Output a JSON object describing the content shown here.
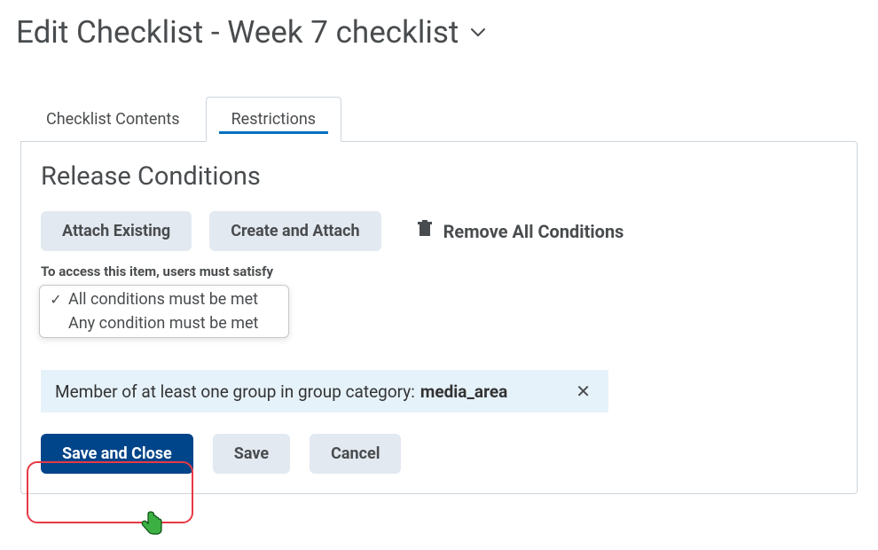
{
  "page_title": "Edit Checklist - Week 7 checklist",
  "tabs": {
    "contents": "Checklist Contents",
    "restrictions": "Restrictions"
  },
  "section_heading": "Release Conditions",
  "buttons": {
    "attach_existing": "Attach Existing",
    "create_and_attach": "Create and Attach",
    "remove_all": "Remove All Conditions",
    "save_and_close": "Save and Close",
    "save": "Save",
    "cancel": "Cancel"
  },
  "helper_text": "To access this item, users must satisfy",
  "satisfy_options": {
    "all": "All conditions must be met",
    "any": "Any condition must be met"
  },
  "condition": {
    "prefix": "Member of at least one group in group category: ",
    "name": "media_area"
  }
}
